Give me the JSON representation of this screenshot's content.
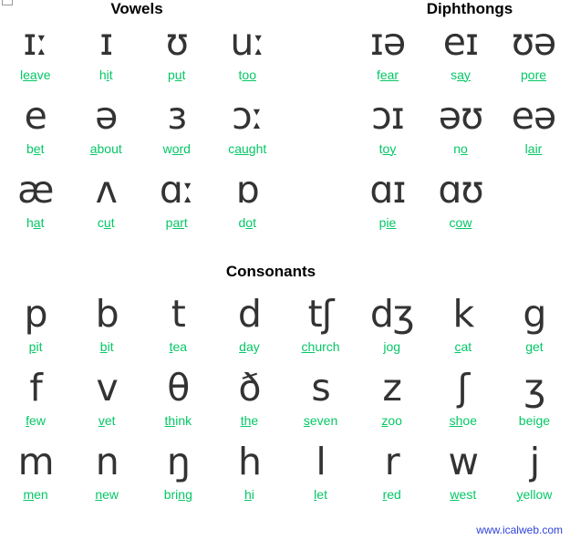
{
  "headings": {
    "vowels": "Vowels",
    "diphthongs": "Diphthongs",
    "consonants": "Consonants"
  },
  "colors": {
    "symbol": "#333333",
    "word": "#05c766",
    "heading": "#000000",
    "url": "#2f43d8",
    "background": "#ffffff"
  },
  "footer": {
    "url": "www.icalweb.com"
  },
  "vowels": [
    {
      "symbol": "ɪː",
      "word": "leave",
      "pre": "l",
      "stress": "ea",
      "post": "ve"
    },
    {
      "symbol": "ɪ",
      "word": "hit",
      "pre": "h",
      "stress": "i",
      "post": "t"
    },
    {
      "symbol": "ʊ",
      "word": "put",
      "pre": "p",
      "stress": "u",
      "post": "t"
    },
    {
      "symbol": "uː",
      "word": "too",
      "pre": "t",
      "stress": "oo",
      "post": ""
    },
    {
      "symbol": "e",
      "word": "bet",
      "pre": "b",
      "stress": "e",
      "post": "t"
    },
    {
      "symbol": "ə",
      "word": "about",
      "pre": "",
      "stress": "a",
      "post": "bout"
    },
    {
      "symbol": "ɜ",
      "word": "word",
      "pre": "w",
      "stress": "or",
      "post": "d"
    },
    {
      "symbol": "ɔː",
      "word": "caught",
      "pre": "c",
      "stress": "au",
      "post": "ght"
    },
    {
      "symbol": "æ",
      "word": "hat",
      "pre": "h",
      "stress": "a",
      "post": "t"
    },
    {
      "symbol": "ʌ",
      "word": "cut",
      "pre": "c",
      "stress": "u",
      "post": "t"
    },
    {
      "symbol": "ɑː",
      "word": "part",
      "pre": "p",
      "stress": "ar",
      "post": "t"
    },
    {
      "symbol": "ɒ",
      "word": "dot",
      "pre": "d",
      "stress": "o",
      "post": "t"
    }
  ],
  "diphthongs": [
    {
      "symbol": "ɪə",
      "word": "fear",
      "pre": "f",
      "stress": "ear",
      "post": ""
    },
    {
      "symbol": "eɪ",
      "word": "say",
      "pre": "s",
      "stress": "ay",
      "post": ""
    },
    {
      "symbol": "ʊə",
      "word": "pore",
      "pre": "p",
      "stress": "ore",
      "post": ""
    },
    {
      "symbol": "ɔɪ",
      "word": "toy",
      "pre": "t",
      "stress": "oy",
      "post": ""
    },
    {
      "symbol": "əʊ",
      "word": "no",
      "pre": "n",
      "stress": "o",
      "post": ""
    },
    {
      "symbol": "eə",
      "word": "lair",
      "pre": "l",
      "stress": "air",
      "post": ""
    },
    {
      "symbol": "ɑɪ",
      "word": "pie",
      "pre": "p",
      "stress": "ie",
      "post": ""
    },
    {
      "symbol": "ɑʊ",
      "word": "cow",
      "pre": "c",
      "stress": "ow",
      "post": ""
    }
  ],
  "consonants": [
    {
      "symbol": "p",
      "word": "pit",
      "pre": "",
      "stress": "p",
      "post": "it"
    },
    {
      "symbol": "b",
      "word": "bit",
      "pre": "",
      "stress": "b",
      "post": "it"
    },
    {
      "symbol": "t",
      "word": "tea",
      "pre": "",
      "stress": "t",
      "post": "ea"
    },
    {
      "symbol": "d",
      "word": "day",
      "pre": "",
      "stress": "d",
      "post": "ay"
    },
    {
      "symbol": "tʃ",
      "word": "church",
      "pre": "",
      "stress": "ch",
      "post": "urch"
    },
    {
      "symbol": "dʒ",
      "word": "jog",
      "pre": "",
      "stress": "j",
      "post": "og"
    },
    {
      "symbol": "k",
      "word": "cat",
      "pre": "",
      "stress": "c",
      "post": "at"
    },
    {
      "symbol": "g",
      "word": "get",
      "pre": "",
      "stress": "g",
      "post": "et"
    },
    {
      "symbol": "f",
      "word": "few",
      "pre": "",
      "stress": "f",
      "post": "ew"
    },
    {
      "symbol": "v",
      "word": "vet",
      "pre": "",
      "stress": "v",
      "post": "et"
    },
    {
      "symbol": "θ",
      "word": "think",
      "pre": "",
      "stress": "th",
      "post": "ink"
    },
    {
      "symbol": "ð",
      "word": "the",
      "pre": "",
      "stress": "th",
      "post": "e"
    },
    {
      "symbol": "s",
      "word": "seven",
      "pre": "",
      "stress": "s",
      "post": "even"
    },
    {
      "symbol": "z",
      "word": "zoo",
      "pre": "",
      "stress": "z",
      "post": "oo"
    },
    {
      "symbol": "ʃ",
      "word": "shoe",
      "pre": "",
      "stress": "sh",
      "post": "oe"
    },
    {
      "symbol": "ʒ",
      "word": "beige",
      "pre": "bei",
      "stress": "g",
      "post": "e"
    },
    {
      "symbol": "m",
      "word": "men",
      "pre": "",
      "stress": "m",
      "post": "en"
    },
    {
      "symbol": "n",
      "word": "new",
      "pre": "",
      "stress": "n",
      "post": "ew"
    },
    {
      "symbol": "ŋ",
      "word": "bring",
      "pre": "bri",
      "stress": "ng",
      "post": ""
    },
    {
      "symbol": "h",
      "word": "hi",
      "pre": "",
      "stress": "h",
      "post": "i"
    },
    {
      "symbol": "l",
      "word": "let",
      "pre": "",
      "stress": "l",
      "post": "et"
    },
    {
      "symbol": "r",
      "word": "red",
      "pre": "",
      "stress": "r",
      "post": "ed"
    },
    {
      "symbol": "w",
      "word": "west",
      "pre": "",
      "stress": "w",
      "post": "est"
    },
    {
      "symbol": "j",
      "word": "yellow",
      "pre": "",
      "stress": "y",
      "post": "ellow"
    }
  ]
}
